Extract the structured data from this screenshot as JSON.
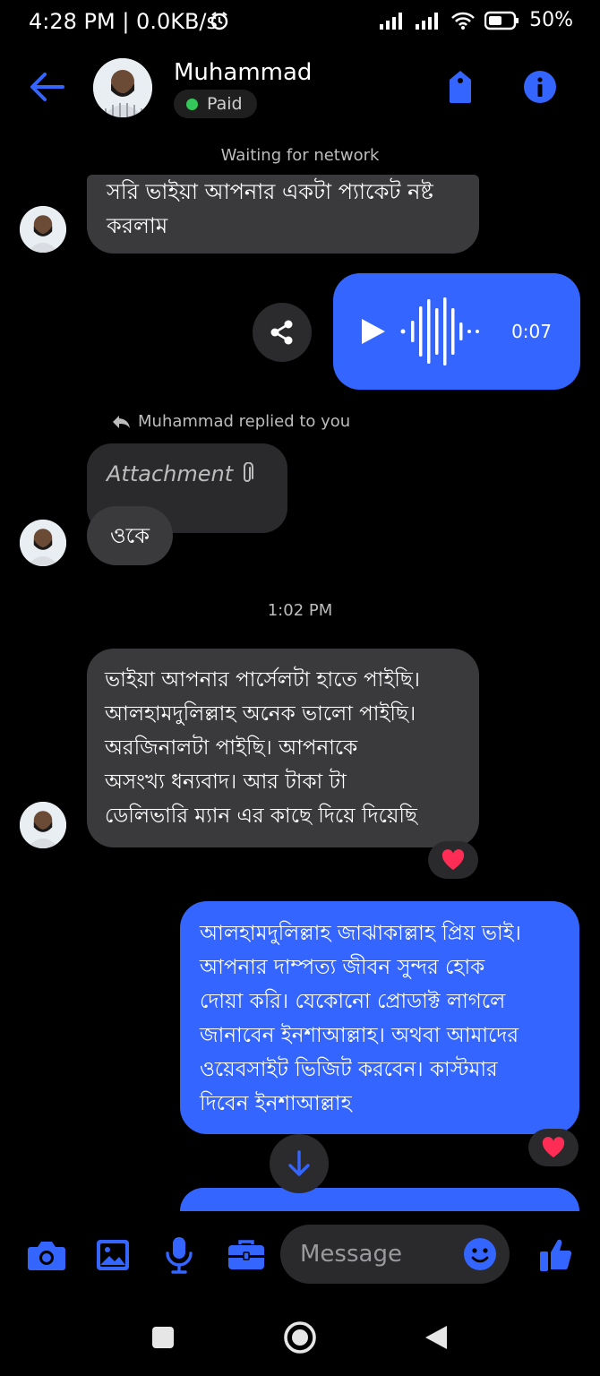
{
  "status_bar": {
    "time": "4:28 PM | 0.0KB/s",
    "battery": "50%"
  },
  "header": {
    "name": "Muhammad",
    "badge": "Paid"
  },
  "network": "Waiting for network",
  "messages": {
    "m1_text": "সরি ভাইয়া আপনার একটা প্যাকেট নষ্ট\nকরলাম",
    "voice_duration": "0:07",
    "reply_note": "Muhammad replied to you",
    "attachment_label": "Attachment",
    "m2_text": "ওকে",
    "timestamp": "1:02 PM",
    "m3_text": "ভাইয়া আপনার পার্সেলটা হাতে পাইছি।\n আলহামদুলিল্লাহ অনেক ভালো পাইছি।\n অরজিনালটা পাইছি। আপনাকে\nঅসংখ্য ধন্যবাদ। আর টাকা টা\nডেলিভারি ম্যান এর কাছে দিয়ে দিয়েছি",
    "m4_text": "আলহামদুলিল্লাহ জাঝাকাল্লাহ প্রিয় ভাই।\nআপনার দাম্পত্য জীবন সুন্দর হোক\nদোয়া করি। যেকোনো প্রোডাক্ট লাগলে\nজানাবেন ইনশাআল্লাহ। অথবা আমাদের\nওয়েবসাইট ভিজিট করবেন। কাস্টমার\nদিবেন ইনশাআল্লাহ"
  },
  "composer": {
    "placeholder": "Message"
  },
  "colors": {
    "accent": "#3466ff",
    "badge_dot": "#34c759",
    "heart": "#ff2d55"
  }
}
